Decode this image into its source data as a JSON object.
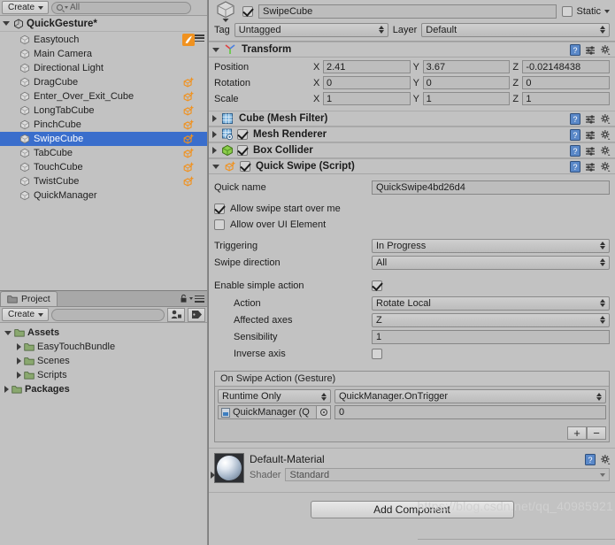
{
  "hierarchy": {
    "create_label": "Create",
    "search_placeholder": "All",
    "scene_name": "QuickGesture*",
    "items": [
      {
        "name": "Easytouch",
        "icon": "easytouch-icon",
        "selected": false
      },
      {
        "name": "Main Camera",
        "icon": "none",
        "selected": false
      },
      {
        "name": "Directional Light",
        "icon": "none",
        "selected": false
      },
      {
        "name": "DragCube",
        "icon": "gesture-icon",
        "selected": false
      },
      {
        "name": "Enter_Over_Exit_Cube",
        "icon": "gesture-icon",
        "selected": false
      },
      {
        "name": "LongTabCube",
        "icon": "gesture-icon",
        "selected": false
      },
      {
        "name": "PinchCube",
        "icon": "gesture-icon",
        "selected": false
      },
      {
        "name": "SwipeCube",
        "icon": "gesture-icon",
        "selected": true
      },
      {
        "name": "TabCube",
        "icon": "gesture-icon",
        "selected": false
      },
      {
        "name": "TouchCube",
        "icon": "gesture-icon",
        "selected": false
      },
      {
        "name": "TwistCube",
        "icon": "gesture-icon",
        "selected": false
      },
      {
        "name": "QuickManager",
        "icon": "none",
        "selected": false
      }
    ]
  },
  "project": {
    "tab_label": "Project",
    "create_label": "Create",
    "search_placeholder": "",
    "items": [
      {
        "name": "Assets",
        "depth": 0,
        "expanded": true,
        "bold": true
      },
      {
        "name": "EasyTouchBundle",
        "depth": 1,
        "expanded": false,
        "bold": false
      },
      {
        "name": "Scenes",
        "depth": 1,
        "expanded": false,
        "bold": false
      },
      {
        "name": "Scripts",
        "depth": 1,
        "expanded": false,
        "bold": false
      },
      {
        "name": "Packages",
        "depth": 0,
        "expanded": false,
        "bold": true
      }
    ]
  },
  "inspector": {
    "object_name": "SwipeCube",
    "object_enabled": true,
    "static_label": "Static",
    "static_checked": false,
    "tag_label": "Tag",
    "tag_value": "Untagged",
    "layer_label": "Layer",
    "layer_value": "Default",
    "transform": {
      "title": "Transform",
      "rows": [
        {
          "label": "Position",
          "x": "2.41",
          "y": "3.67",
          "z": "-0.02148438"
        },
        {
          "label": "Rotation",
          "x": "0",
          "y": "0",
          "z": "0"
        },
        {
          "label": "Scale",
          "x": "1",
          "y": "1",
          "z": "1"
        }
      ],
      "axis_labels": [
        "X",
        "Y",
        "Z"
      ]
    },
    "components": [
      {
        "title": "Cube (Mesh Filter)",
        "icon": "mesh-filter-icon",
        "has_checkbox": false,
        "checked": false,
        "expanded": false
      },
      {
        "title": "Mesh Renderer",
        "icon": "mesh-renderer-icon",
        "has_checkbox": true,
        "checked": true,
        "expanded": false
      },
      {
        "title": "Box Collider",
        "icon": "box-collider-icon",
        "has_checkbox": true,
        "checked": true,
        "expanded": false
      },
      {
        "title": "Quick Swipe (Script)",
        "icon": "gesture-icon",
        "has_checkbox": true,
        "checked": true,
        "expanded": true
      }
    ],
    "quick_swipe": {
      "quick_name_label": "Quick name",
      "quick_name_value": "QuickSwipe4bd26d4",
      "allow_start_label": "Allow swipe start over me",
      "allow_start_checked": true,
      "allow_ui_label": "Allow over UI Element",
      "allow_ui_checked": false,
      "triggering_label": "Triggering",
      "triggering_value": "In Progress",
      "direction_label": "Swipe direction",
      "direction_value": "All",
      "enable_action_label": "Enable simple action",
      "enable_action_checked": true,
      "action_label": "Action",
      "action_value": "Rotate Local",
      "axes_label": "Affected axes",
      "axes_value": "Z",
      "sensibility_label": "Sensibility",
      "sensibility_value": "1",
      "inverse_label": "Inverse axis",
      "inverse_checked": false
    },
    "event": {
      "title": "On Swipe Action (Gesture)",
      "mode": "Runtime Only",
      "function": "QuickManager.OnTrigger",
      "object": "QuickManager (Q",
      "argument": "0",
      "add_label": "+",
      "remove_label": "−"
    },
    "material": {
      "name": "Default-Material",
      "shader_label": "Shader",
      "shader_value": "Standard"
    },
    "add_component_label": "Add Component"
  },
  "watermark": "https://blog.csdn.net/qq_40985921",
  "colors": {
    "selection_blue": "#3a6ecc",
    "panel_bg": "#c2c2c2",
    "field_bg": "#bdbdbd",
    "gesture_orange": "#f09220"
  }
}
